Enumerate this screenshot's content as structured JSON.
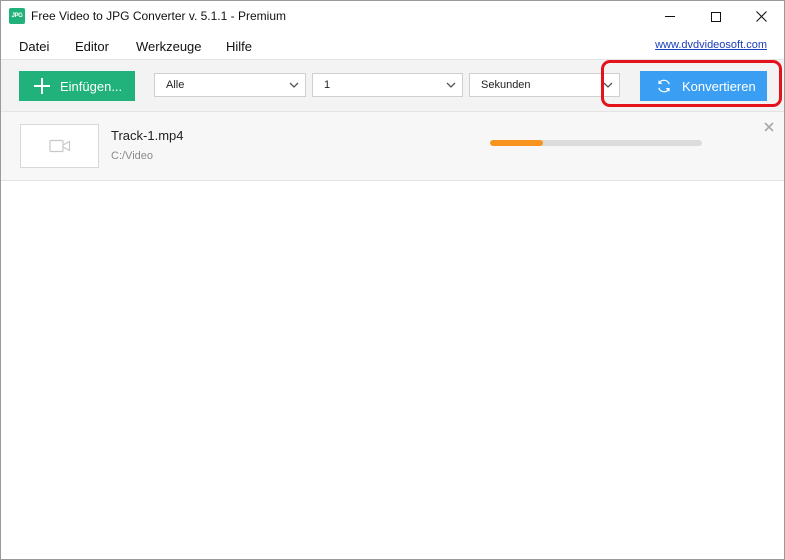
{
  "window": {
    "icon_text": "JPG",
    "title": "Free Video to JPG Converter v. 5.1.1 - Premium"
  },
  "menu": {
    "items": [
      "Datei",
      "Editor",
      "Werkzeuge",
      "Hilfe"
    ],
    "site_link": "www.dvdvideosoft.com"
  },
  "toolbar": {
    "add_label": "Einfügen...",
    "mode_select": {
      "value": "Alle"
    },
    "count_select": {
      "value": "1"
    },
    "unit_select": {
      "value": "Sekunden"
    },
    "convert_label": "Konvertieren"
  },
  "files": [
    {
      "name": "Track-1.mp4",
      "path": "C:/Video",
      "progress": 0.25
    }
  ],
  "colors": {
    "accent_green": "#20b27a",
    "accent_blue": "#3a9ff3",
    "progress": "#f7931e",
    "highlight_annotation": "#e4121b"
  },
  "icons": [
    "app-logo-icon",
    "minimize-icon",
    "maximize-icon",
    "close-icon",
    "plus-icon",
    "chevron-down-icon",
    "refresh-icon",
    "video-camera-icon",
    "remove-icon"
  ]
}
